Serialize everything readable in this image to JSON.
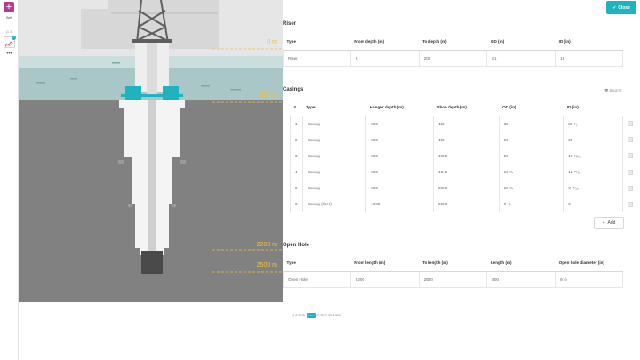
{
  "rail": {
    "add_label": "+",
    "well_label": "Well",
    "version_label": "(1.3)",
    "more_label": "•••"
  },
  "diagram": {
    "depths": [
      {
        "label": "0 m"
      },
      {
        "label": "200 m"
      },
      {
        "label": "2200 m"
      },
      {
        "label": "2500 m"
      }
    ],
    "colors": {
      "sky": "#e3e3e3",
      "water": "#a9c7c6",
      "seabed": "#818181",
      "highlight": "#f2c23a",
      "wellhead": "#1fb3bf"
    }
  },
  "header": {
    "close_label": "Close"
  },
  "riser": {
    "title": "Riser",
    "columns": [
      "Type",
      "From depth (m)",
      "To depth (m)",
      "OD (in)",
      "ID (in)"
    ],
    "rows": [
      [
        "Riser",
        "0",
        "200",
        "21",
        "19"
      ]
    ]
  },
  "casings": {
    "title": "Casings",
    "delete_label": "DELETE",
    "columns": [
      "#",
      "Type",
      "Hanger depth (m)",
      "Shoe depth (m)",
      "OD (in)",
      "ID (in)"
    ],
    "rows": [
      [
        "1",
        "Casing",
        "200",
        "422",
        "32",
        "30 ¹⁄₂"
      ],
      [
        "2",
        "Casing",
        "200",
        "465",
        "26",
        "25"
      ],
      [
        "3",
        "Casing",
        "200",
        "1055",
        "20",
        "18 ¾⁄₁₆"
      ],
      [
        "4",
        "Casing",
        "200",
        "1616",
        "13 ⅜",
        "12 ¹⁵⁄₁₆"
      ],
      [
        "5",
        "Casing",
        "200",
        "2000",
        "10 ¾",
        "9 ¹⁵⁄₁₆"
      ],
      [
        "6",
        "Casing (liner)",
        "1995",
        "2200",
        "9 ⅝",
        "9"
      ]
    ],
    "add_label": "Add"
  },
  "open_hole": {
    "title": "Open Hole",
    "columns": [
      "Type",
      "From length (m)",
      "To length (m)",
      "Length (m)",
      "Open hole diameter (in)"
    ],
    "rows": [
      [
        "Open Hole",
        "2200",
        "2500",
        "300",
        "8 ½"
      ]
    ]
  },
  "footer": {
    "version": "v1.9.2125",
    "badge": "beta",
    "copyright": "© 2017-2018 IRIS"
  }
}
